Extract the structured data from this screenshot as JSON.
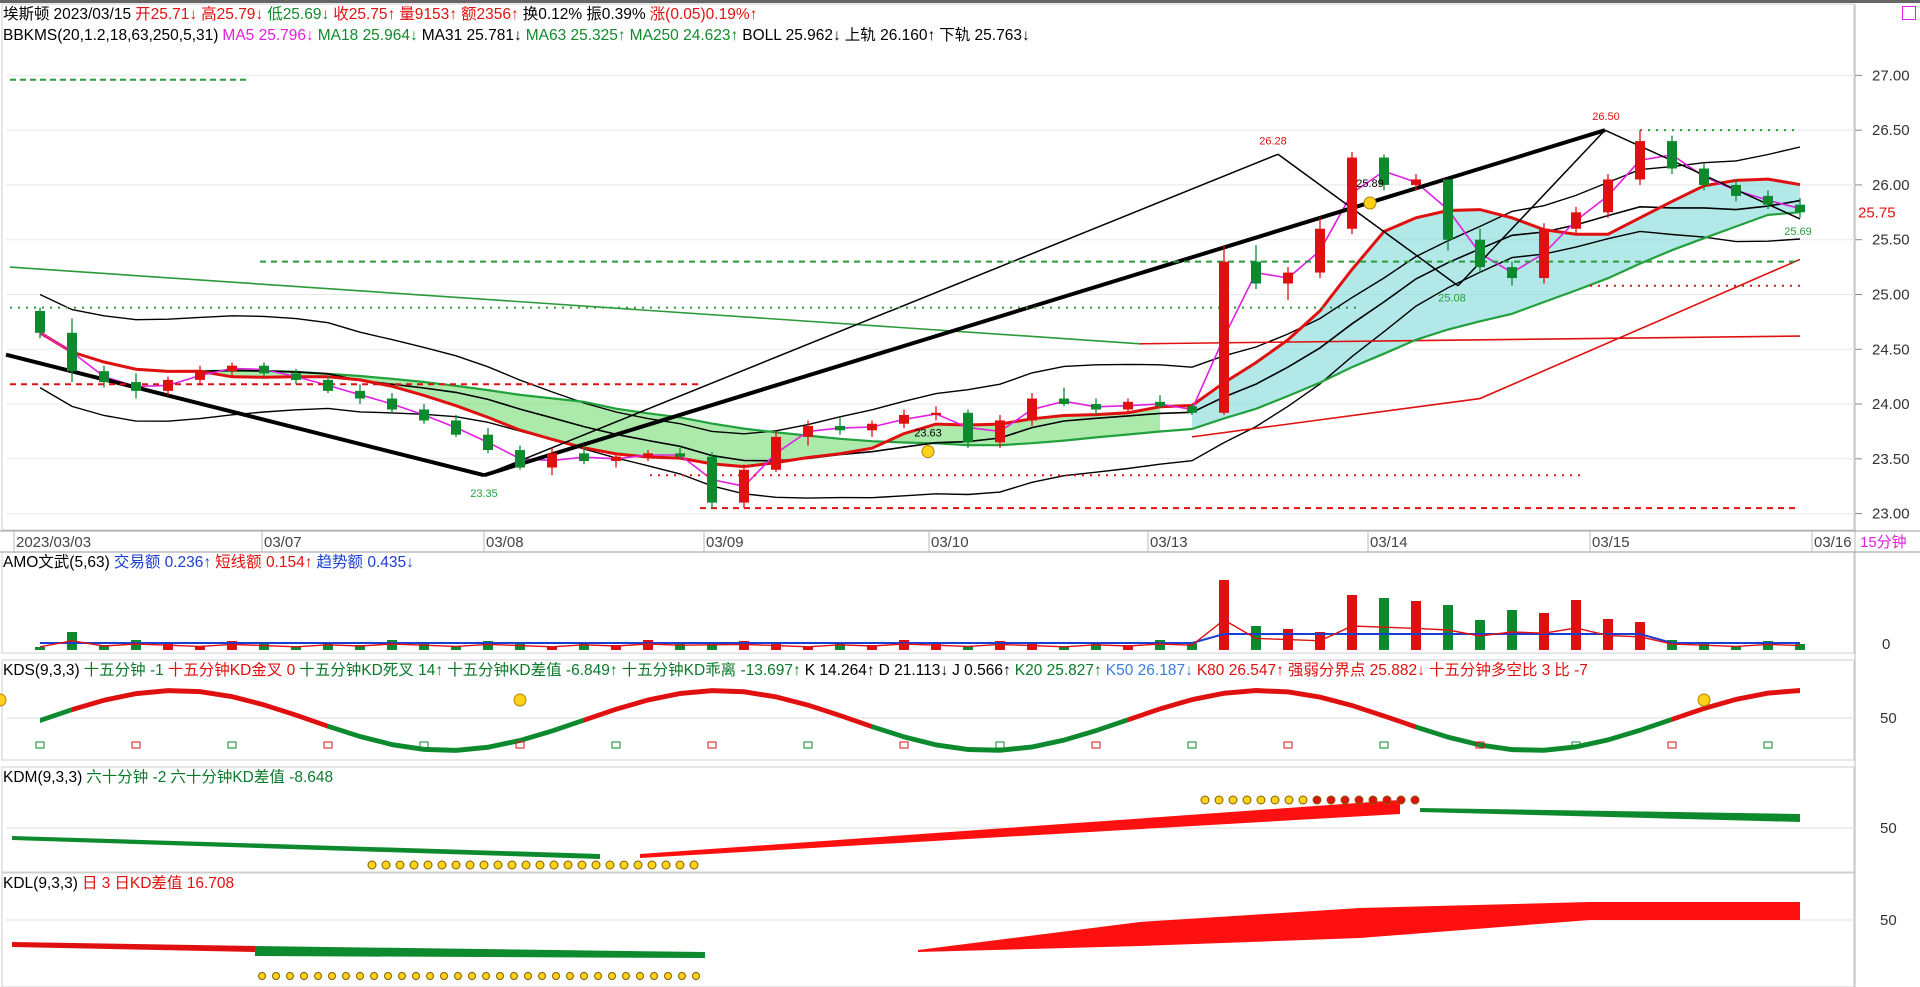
{
  "header": {
    "stock_name": "埃斯顿",
    "date": "2023/03/15",
    "open": "开25.71↓",
    "high": "高25.79↓",
    "low": "低25.69↓",
    "close": "收25.75↑",
    "volume": "量9153↑",
    "amount": "额2356↑",
    "turnover": "换0.12%",
    "amplitude": "振0.39%",
    "change": "涨(0.05)0.19%↑"
  },
  "indicator_line": {
    "name": "BBKMS(20,1.2,18,63,250,5,31)",
    "ma5": "MA5 25.796↓",
    "ma18": "MA18 25.964↓",
    "ma31": "MA31 25.781↓",
    "ma63": "MA63 25.325↑",
    "ma250": "MA250 24.623↑",
    "boll": "BOLL 25.962↓",
    "upper": "上轨 26.160↑",
    "lower": "下轨 25.763↓"
  },
  "price_axis": [
    "27.00",
    "26.50",
    "26.00",
    "25.50",
    "25.00",
    "24.50",
    "24.00",
    "23.50",
    "23.00"
  ],
  "last_price_tag": "25.75",
  "period_label": "15分钟",
  "dates": [
    "2023/03/03",
    "03/07",
    "03/08",
    "03/09",
    "03/10",
    "03/13",
    "03/14",
    "03/15",
    "03/16"
  ],
  "annotations": {
    "low1": "23.35",
    "mid": "23.63",
    "peak1": "26.28",
    "peak2": "25.89",
    "trough": "25.08",
    "peak3": "26.50",
    "last": "25.69"
  },
  "amo": {
    "name": "AMO文武(5,63)",
    "trade": "交易额 0.236↑",
    "short": "短线额 0.154↑",
    "trend": "趋势额 0.435↓",
    "axis": "0"
  },
  "kds": {
    "name": "KDS(9,3,3)",
    "a": "十五分钟 -1",
    "b": "十五分钟KD金叉 0",
    "c": "十五分钟KD死叉 14↑",
    "d": "十五分钟KD差值 -6.849↑",
    "e": "十五分钟KD乖离 -13.697↑",
    "k": "K 14.264↑",
    "dv": "D 21.113↓",
    "j": "J 0.566↑",
    "k20": "K20 25.827↑",
    "k50": "K50 26.187↓",
    "k80": "K80 26.547↑",
    "strong": "强弱分界点 25.882↓",
    "ratio": "十五分钟多空比 3",
    "bi": "比 -7",
    "axis": "50"
  },
  "kdm": {
    "name": "KDM(9,3,3)",
    "a": "六十分钟 -2",
    "b": "六十分钟KD差值 -8.648",
    "axis": "50"
  },
  "kdl": {
    "name": "KDL(9,3,3)",
    "a": "日 3",
    "b": "日KD差值 16.708",
    "axis": "50"
  },
  "chart_data": {
    "type": "candlestick",
    "title": "埃斯顿 15分钟",
    "ylim": [
      23.0,
      27.2
    ],
    "candles_approx": [
      [
        24.85,
        24.88,
        24.6,
        24.65
      ],
      [
        24.65,
        24.78,
        24.2,
        24.3
      ],
      [
        24.3,
        24.35,
        24.15,
        24.2
      ],
      [
        24.2,
        24.28,
        24.05,
        24.12
      ],
      [
        24.12,
        24.25,
        24.08,
        24.22
      ],
      [
        24.22,
        24.35,
        24.18,
        24.3
      ],
      [
        24.3,
        24.38,
        24.25,
        24.35
      ],
      [
        24.35,
        24.38,
        24.25,
        24.28
      ],
      [
        24.28,
        24.32,
        24.18,
        24.22
      ],
      [
        24.22,
        24.26,
        24.1,
        24.12
      ],
      [
        24.12,
        24.18,
        24.0,
        24.05
      ],
      [
        24.05,
        24.1,
        23.92,
        23.95
      ],
      [
        23.95,
        24.0,
        23.82,
        23.85
      ],
      [
        23.85,
        23.9,
        23.7,
        23.72
      ],
      [
        23.72,
        23.78,
        23.55,
        23.58
      ],
      [
        23.58,
        23.62,
        23.4,
        23.42
      ],
      [
        23.42,
        23.6,
        23.35,
        23.55
      ],
      [
        23.55,
        23.62,
        23.45,
        23.48
      ],
      [
        23.48,
        23.55,
        23.42,
        23.52
      ],
      [
        23.52,
        23.58,
        23.48,
        23.55
      ],
      [
        23.55,
        23.6,
        23.5,
        23.52
      ],
      [
        23.52,
        23.56,
        23.05,
        23.1
      ],
      [
        23.1,
        23.45,
        23.05,
        23.4
      ],
      [
        23.4,
        23.75,
        23.38,
        23.7
      ],
      [
        23.7,
        23.85,
        23.62,
        23.8
      ],
      [
        23.8,
        23.88,
        23.72,
        23.76
      ],
      [
        23.76,
        23.85,
        23.7,
        23.82
      ],
      [
        23.82,
        23.95,
        23.78,
        23.9
      ],
      [
        23.9,
        23.98,
        23.85,
        23.92
      ],
      [
        23.92,
        23.95,
        23.6,
        23.65
      ],
      [
        23.65,
        23.9,
        23.6,
        23.85
      ],
      [
        23.85,
        24.1,
        23.8,
        24.05
      ],
      [
        24.05,
        24.15,
        23.98,
        24.0
      ],
      [
        24.0,
        24.05,
        23.9,
        23.95
      ],
      [
        23.95,
        24.05,
        23.92,
        24.02
      ],
      [
        24.02,
        24.08,
        23.96,
        23.98
      ],
      [
        23.98,
        24.0,
        23.9,
        23.92
      ],
      [
        23.92,
        25.45,
        23.9,
        25.3
      ],
      [
        25.3,
        25.45,
        25.05,
        25.1
      ],
      [
        25.1,
        25.25,
        24.95,
        25.2
      ],
      [
        25.2,
        25.7,
        25.15,
        25.6
      ],
      [
        25.6,
        26.3,
        25.55,
        26.25
      ],
      [
        26.25,
        26.28,
        25.95,
        26.0
      ],
      [
        26.0,
        26.1,
        25.95,
        26.05
      ],
      [
        26.05,
        25.95,
        25.4,
        25.5
      ],
      [
        25.5,
        25.6,
        25.2,
        25.25
      ],
      [
        25.25,
        25.3,
        25.08,
        25.15
      ],
      [
        25.15,
        25.65,
        25.1,
        25.6
      ],
      [
        25.6,
        25.8,
        25.55,
        25.75
      ],
      [
        25.75,
        26.1,
        25.7,
        26.05
      ],
      [
        26.05,
        26.5,
        26.0,
        26.4
      ],
      [
        26.4,
        26.45,
        26.1,
        26.15
      ],
      [
        26.15,
        26.2,
        25.95,
        26.0
      ],
      [
        26.0,
        26.05,
        25.85,
        25.9
      ],
      [
        25.9,
        25.95,
        25.78,
        25.82
      ],
      [
        25.82,
        25.88,
        25.7,
        25.75
      ]
    ],
    "series": [
      {
        "name": "MA5",
        "color": "#e020e0"
      },
      {
        "name": "MA18",
        "color": "#22a03c"
      },
      {
        "name": "MA31",
        "color": "#000000"
      },
      {
        "name": "MA63",
        "color": "#22a03c"
      },
      {
        "name": "MA250",
        "color": "#22a03c"
      },
      {
        "name": "BOLL",
        "color": "#000000"
      }
    ],
    "price_markers": [
      {
        "label": "23.35",
        "value": 23.35
      },
      {
        "label": "23.63",
        "value": 23.63
      },
      {
        "label": "26.28",
        "value": 26.28
      },
      {
        "label": "25.89",
        "value": 25.89
      },
      {
        "label": "25.08",
        "value": 25.08
      },
      {
        "label": "26.50",
        "value": 26.5
      },
      {
        "label": "25.69",
        "value": 25.69
      }
    ]
  }
}
